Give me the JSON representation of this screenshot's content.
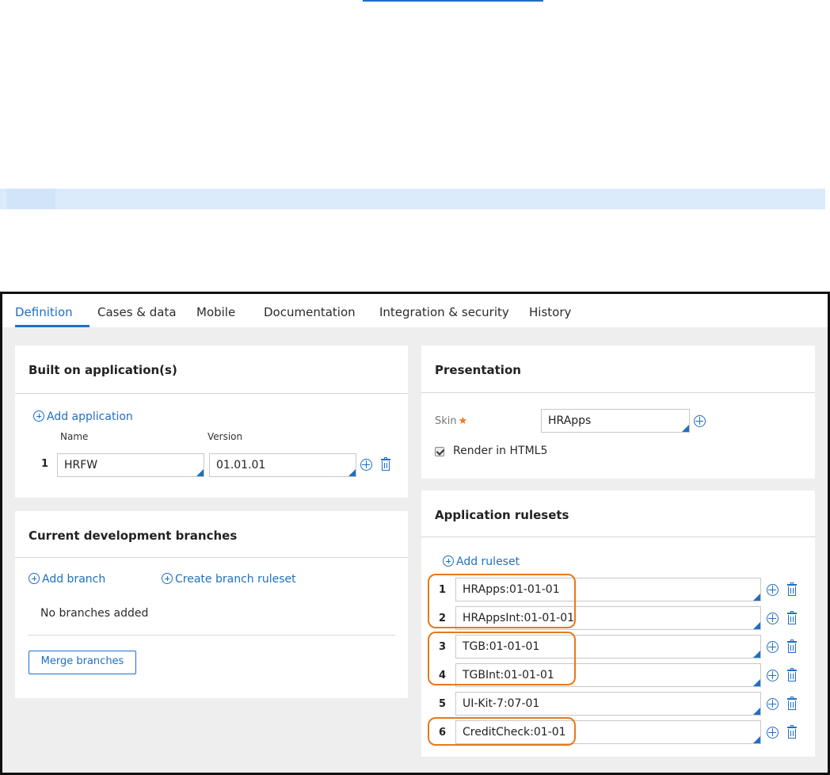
{
  "tabs": [
    {
      "label": "Definition",
      "active": true
    },
    {
      "label": "Cases & data"
    },
    {
      "label": "Mobile"
    },
    {
      "label": "Documentation"
    },
    {
      "label": "Integration & security"
    },
    {
      "label": "History"
    }
  ],
  "built_on": {
    "title": "Built on application(s)",
    "add_label": "Add application",
    "col_name": "Name",
    "col_version": "Version",
    "rows": [
      {
        "num": "1",
        "name": "HRFW",
        "version": "01.01.01"
      }
    ]
  },
  "branches": {
    "title": "Current development branches",
    "add_branch": "Add branch",
    "create_ruleset": "Create branch ruleset",
    "empty_text": "No branches added",
    "merge_button": "Merge branches"
  },
  "presentation": {
    "title": "Presentation",
    "skin_label": "Skin",
    "required_mark": "★",
    "skin_value": "HRApps",
    "render_label": "Render in HTML5",
    "render_checked": true
  },
  "rulesets": {
    "title": "Application rulesets",
    "add_label": "Add ruleset",
    "rows": [
      {
        "num": "1",
        "value": "HRApps:01-01-01"
      },
      {
        "num": "2",
        "value": "HRAppsInt:01-01-01"
      },
      {
        "num": "3",
        "value": "TGB:01-01-01"
      },
      {
        "num": "4",
        "value": "TGBInt:01-01-01"
      },
      {
        "num": "5",
        "value": "UI-Kit-7:07-01"
      },
      {
        "num": "6",
        "value": "CreditCheck:01-01"
      }
    ]
  },
  "colors": {
    "accent": "#1f6fc4",
    "highlight": "#e8781b",
    "strip": "#dcebfb",
    "background": "#eeeeee"
  }
}
